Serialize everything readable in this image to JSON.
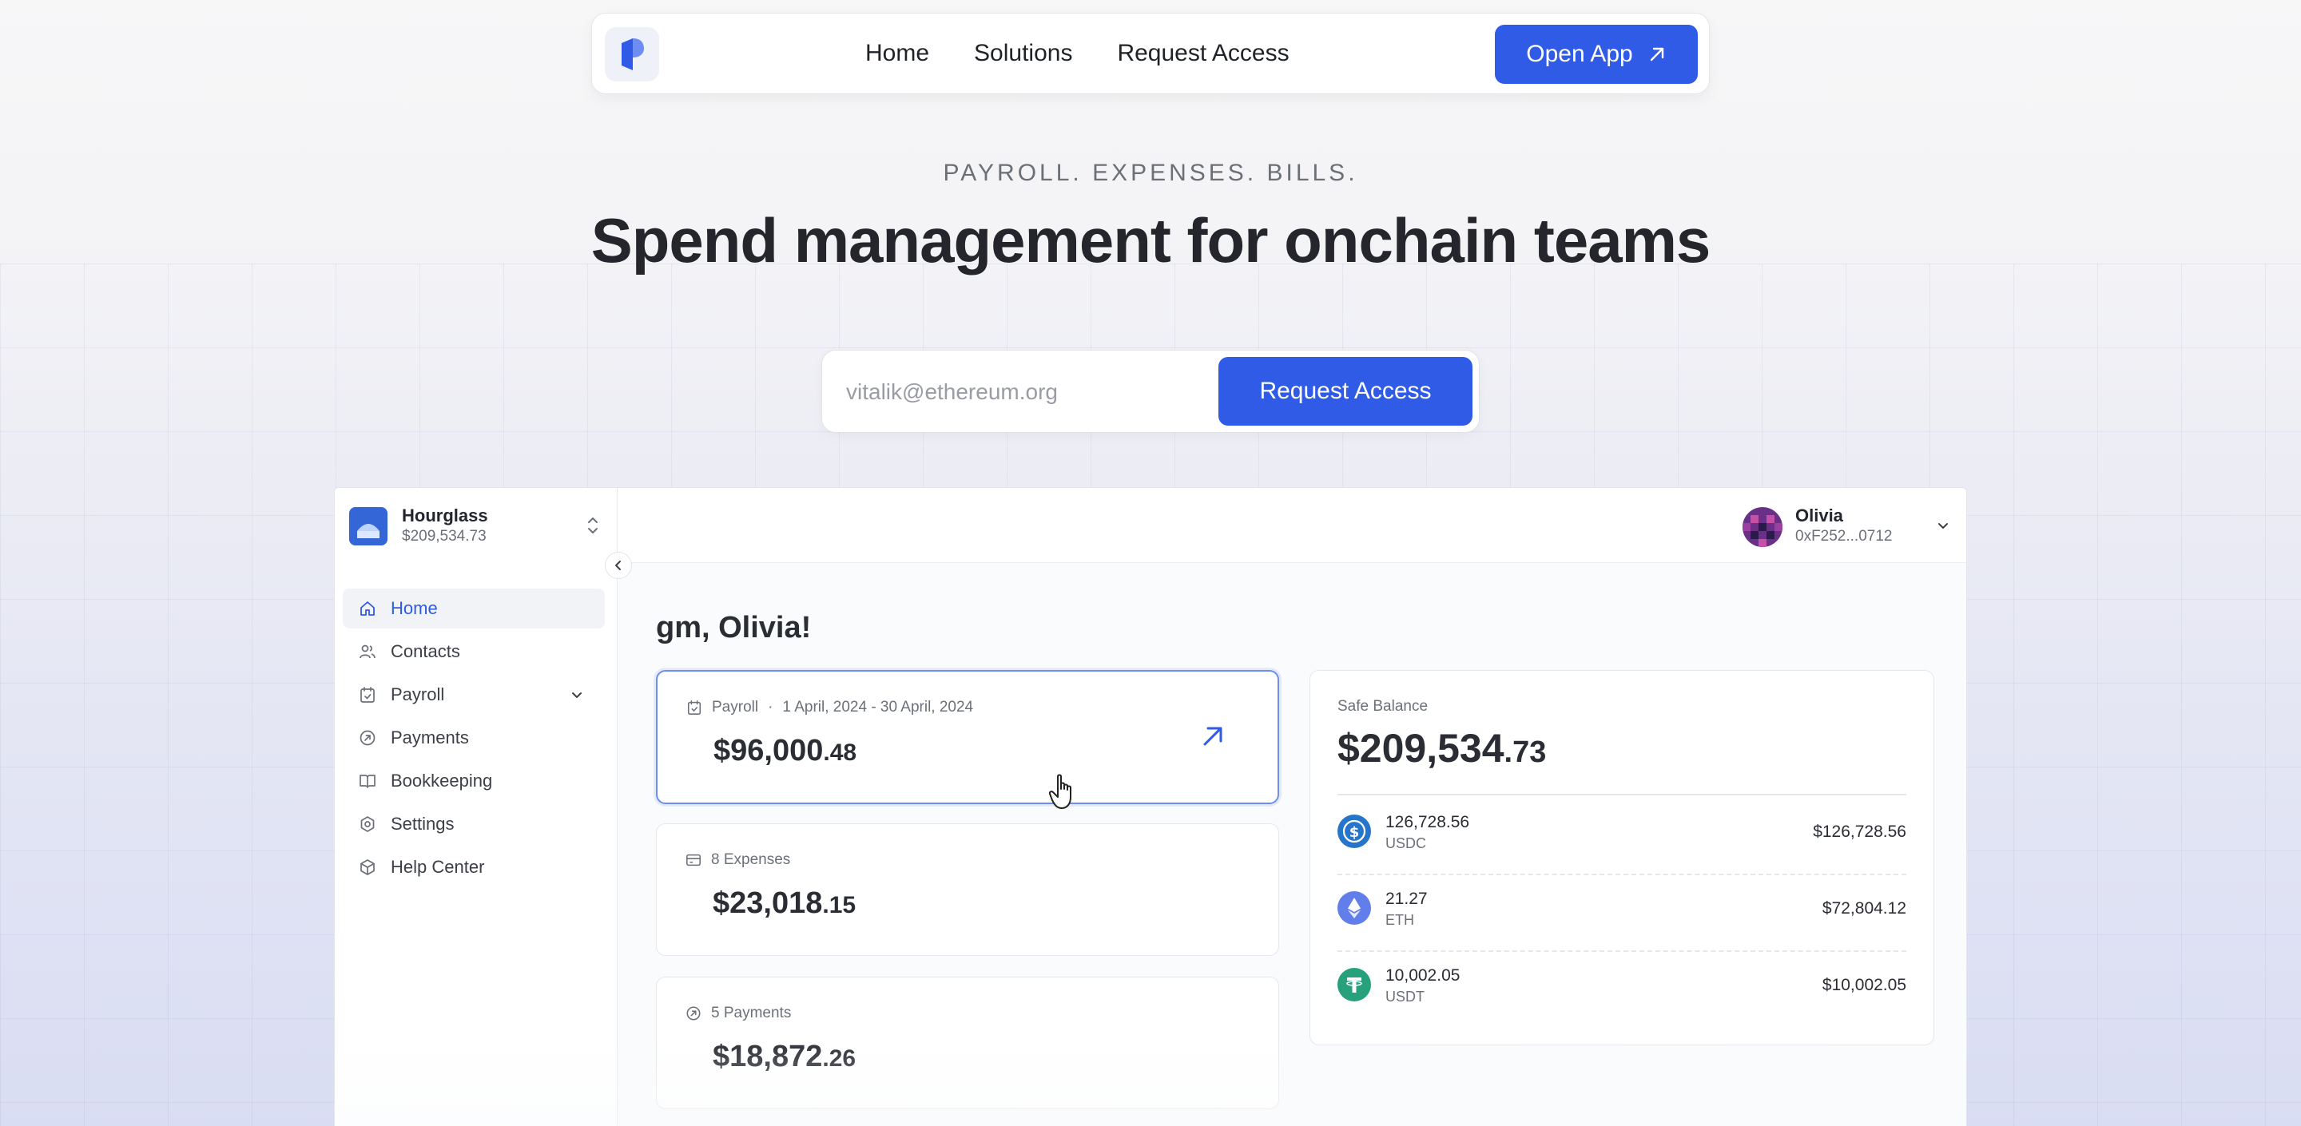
{
  "nav": {
    "links": [
      "Home",
      "Solutions",
      "Request Access"
    ],
    "open_app_label": "Open App"
  },
  "hero": {
    "eyebrow": "PAYROLL. EXPENSES. BILLS.",
    "headline": "Spend management for onchain teams",
    "email_placeholder": "vitalik@ethereum.org",
    "cta_label": "Request Access"
  },
  "app": {
    "org": {
      "name": "Hourglass",
      "balance": "$209,534.73"
    },
    "sidebar": {
      "items": [
        {
          "label": "Home",
          "icon": "home-icon",
          "active": true
        },
        {
          "label": "Contacts",
          "icon": "users-icon"
        },
        {
          "label": "Payroll",
          "icon": "calendar-icon"
        },
        {
          "label": "Payments",
          "icon": "payments-icon"
        },
        {
          "label": "Bookkeeping",
          "icon": "book-icon"
        },
        {
          "label": "Settings",
          "icon": "settings-icon"
        },
        {
          "label": "Help Center",
          "icon": "help-icon"
        }
      ]
    },
    "user": {
      "name": "Olivia",
      "address": "0xF252...0712"
    },
    "greeting": "gm, Olivia!",
    "cards": {
      "payroll": {
        "label": "Payroll",
        "separator": "·",
        "period": "1 April, 2024 - 30 April, 2024",
        "amount_main": "$96,000",
        "amount_cents": ".48"
      },
      "expenses": {
        "label": "8 Expenses",
        "amount_main": "$23,018",
        "amount_cents": ".15"
      },
      "payments": {
        "label": "5 Payments",
        "amount_main": "$18,872",
        "amount_cents": ".26"
      }
    },
    "safe": {
      "title": "Safe Balance",
      "amount_main": "$209,534",
      "amount_cents": ".73",
      "tokens": [
        {
          "amount": "126,728.56",
          "symbol": "USDC",
          "usd": "$126,728.56",
          "color": "#2775ca"
        },
        {
          "amount": "21.27",
          "symbol": "ETH",
          "usd": "$72,804.12",
          "color": "#627eea"
        },
        {
          "amount": "10,002.05",
          "symbol": "USDT",
          "usd": "$10,002.05",
          "color": "#26a17b"
        }
      ]
    }
  },
  "colors": {
    "accent": "#2f5be6",
    "text": "#1f2328",
    "muted": "#6b7078"
  }
}
